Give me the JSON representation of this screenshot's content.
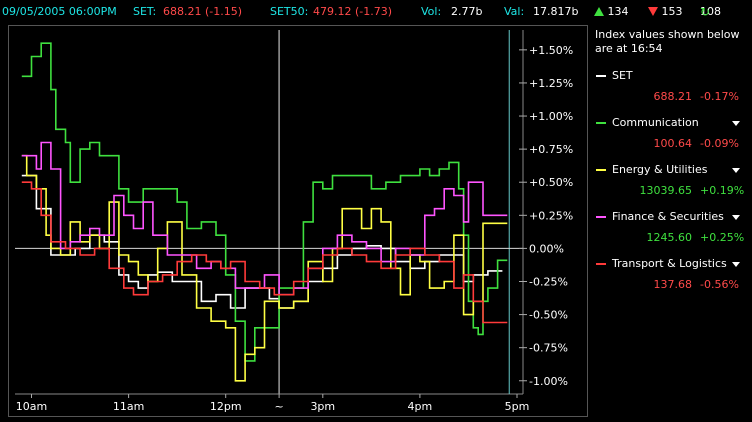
{
  "header": {
    "datetime": "09/05/2005 06:00PM",
    "set_label": "SET:",
    "set_value": "688.21 (-1.15)",
    "set50_label": "SET50:",
    "set50_value": "479.12 (-1.73)",
    "vol_label": "Vol:",
    "vol_value": "2.77b",
    "val_label": "Val:",
    "val_value": "17.817b",
    "up_count": "134",
    "down_count": "153",
    "unchanged_count": "108"
  },
  "sidebar": {
    "heading": "Index values shown below are at 16:54",
    "indices": [
      {
        "name": "SET",
        "value": "688.21",
        "change": "-0.17%",
        "color": "#ffffff",
        "value_color": "#ff4a4a",
        "dropdown": false
      },
      {
        "name": "Communication",
        "value": "100.64",
        "change": "-0.09%",
        "color": "#3fe03f",
        "value_color": "#ff4a4a",
        "dropdown": true
      },
      {
        "name": "Energy & Utilities",
        "value": "13039.65",
        "change": "+0.19%",
        "color": "#ffff44",
        "value_color": "#3fe03f",
        "dropdown": true
      },
      {
        "name": "Finance & Securities",
        "value": "1245.60",
        "change": "+0.25%",
        "color": "#ff55ff",
        "value_color": "#3fe03f",
        "dropdown": true
      },
      {
        "name": "Transport & Logistics",
        "value": "137.68",
        "change": "-0.56%",
        "color": "#ff3a3a",
        "value_color": "#ff4a4a",
        "dropdown": true
      }
    ]
  },
  "chart_data": {
    "type": "line",
    "y_unit": "percent change",
    "ylim": [
      -1.1,
      1.65
    ],
    "y_ticks": [
      1.5,
      1.25,
      1.0,
      0.75,
      0.5,
      0.25,
      0.0,
      -0.25,
      -0.5,
      -0.75,
      -1.0
    ],
    "y_tick_labels": [
      "+1.50%",
      "+1.25%",
      "+1.00%",
      "+0.75%",
      "+0.50%",
      "+0.25%",
      "0.00%",
      "-0.25%",
      "-0.50%",
      "-0.75%",
      "-1.00%"
    ],
    "x_ticks": [
      10,
      11,
      12,
      12.55,
      13,
      14,
      15
    ],
    "x_tick_labels": [
      "10am",
      "11am",
      "12pm",
      "~",
      "3pm",
      "4pm",
      "5pm"
    ],
    "xlim": [
      9.83,
      15.0
    ],
    "session_break_x": 12.55,
    "end_marker_x": 14.92,
    "grid": false,
    "series": [
      {
        "name": "SET",
        "color": "#ffffff",
        "points": [
          [
            9.9,
            0.55
          ],
          [
            10.05,
            0.3
          ],
          [
            10.2,
            -0.05
          ],
          [
            10.3,
            -0.05
          ],
          [
            10.45,
            0.0
          ],
          [
            10.6,
            0.1
          ],
          [
            10.75,
            0.05
          ],
          [
            10.9,
            -0.2
          ],
          [
            11.0,
            -0.25
          ],
          [
            11.1,
            -0.3
          ],
          [
            11.2,
            -0.2
          ],
          [
            11.3,
            -0.18
          ],
          [
            11.45,
            -0.25
          ],
          [
            11.6,
            -0.25
          ],
          [
            11.75,
            -0.4
          ],
          [
            11.9,
            -0.35
          ],
          [
            12.05,
            -0.45
          ],
          [
            12.2,
            -0.3
          ],
          [
            12.3,
            -0.3
          ],
          [
            12.45,
            -0.38
          ],
          [
            12.55,
            -0.45
          ],
          [
            12.7,
            -0.4
          ],
          [
            12.85,
            -0.25
          ],
          [
            13.0,
            -0.15
          ],
          [
            13.15,
            -0.05
          ],
          [
            13.3,
            0.0
          ],
          [
            13.45,
            0.02
          ],
          [
            13.6,
            0.0
          ],
          [
            13.75,
            -0.1
          ],
          [
            13.9,
            -0.15
          ],
          [
            14.05,
            -0.1
          ],
          [
            14.2,
            -0.05
          ],
          [
            14.35,
            -0.05
          ],
          [
            14.45,
            -0.25
          ],
          [
            14.55,
            -0.2
          ],
          [
            14.7,
            -0.17
          ],
          [
            14.85,
            -0.17
          ]
        ]
      },
      {
        "name": "Communication",
        "color": "#3fe03f",
        "points": [
          [
            9.9,
            1.3
          ],
          [
            9.95,
            1.3
          ],
          [
            10.0,
            1.45
          ],
          [
            10.1,
            1.55
          ],
          [
            10.2,
            1.2
          ],
          [
            10.25,
            0.9
          ],
          [
            10.35,
            0.8
          ],
          [
            10.4,
            0.5
          ],
          [
            10.5,
            0.75
          ],
          [
            10.6,
            0.8
          ],
          [
            10.7,
            0.7
          ],
          [
            10.8,
            0.7
          ],
          [
            10.9,
            0.45
          ],
          [
            11.0,
            0.35
          ],
          [
            11.15,
            0.45
          ],
          [
            11.3,
            0.45
          ],
          [
            11.5,
            0.35
          ],
          [
            11.6,
            0.15
          ],
          [
            11.75,
            0.2
          ],
          [
            11.9,
            0.1
          ],
          [
            12.0,
            -0.2
          ],
          [
            12.1,
            -0.55
          ],
          [
            12.2,
            -0.85
          ],
          [
            12.3,
            -0.6
          ],
          [
            12.45,
            -0.6
          ],
          [
            12.55,
            -0.3
          ],
          [
            12.7,
            -0.3
          ],
          [
            12.8,
            0.2
          ],
          [
            12.9,
            0.5
          ],
          [
            13.0,
            0.45
          ],
          [
            13.1,
            0.55
          ],
          [
            13.3,
            0.55
          ],
          [
            13.5,
            0.45
          ],
          [
            13.65,
            0.5
          ],
          [
            13.8,
            0.55
          ],
          [
            14.0,
            0.6
          ],
          [
            14.1,
            0.55
          ],
          [
            14.2,
            0.6
          ],
          [
            14.3,
            0.65
          ],
          [
            14.4,
            0.45
          ],
          [
            14.45,
            0.1
          ],
          [
            14.5,
            -0.4
          ],
          [
            14.55,
            -0.6
          ],
          [
            14.6,
            -0.65
          ],
          [
            14.65,
            -0.4
          ],
          [
            14.7,
            -0.3
          ],
          [
            14.8,
            -0.09
          ],
          [
            14.9,
            -0.09
          ]
        ]
      },
      {
        "name": "Energy & Utilities",
        "color": "#ffff44",
        "points": [
          [
            9.9,
            0.7
          ],
          [
            9.95,
            0.55
          ],
          [
            10.05,
            0.45
          ],
          [
            10.15,
            0.1
          ],
          [
            10.2,
            0.0
          ],
          [
            10.3,
            -0.05
          ],
          [
            10.4,
            0.2
          ],
          [
            10.5,
            0.05
          ],
          [
            10.6,
            0.1
          ],
          [
            10.7,
            0.0
          ],
          [
            10.8,
            0.35
          ],
          [
            10.9,
            -0.05
          ],
          [
            11.0,
            -0.1
          ],
          [
            11.1,
            -0.2
          ],
          [
            11.2,
            -0.25
          ],
          [
            11.3,
            0.0
          ],
          [
            11.4,
            0.2
          ],
          [
            11.5,
            0.2
          ],
          [
            11.55,
            -0.2
          ],
          [
            11.7,
            -0.45
          ],
          [
            11.85,
            -0.55
          ],
          [
            12.0,
            -0.6
          ],
          [
            12.1,
            -1.0
          ],
          [
            12.2,
            -0.8
          ],
          [
            12.3,
            -0.75
          ],
          [
            12.4,
            -0.4
          ],
          [
            12.5,
            -0.4
          ],
          [
            12.55,
            -0.45
          ],
          [
            12.7,
            -0.4
          ],
          [
            12.85,
            -0.1
          ],
          [
            13.0,
            -0.25
          ],
          [
            13.1,
            0.0
          ],
          [
            13.2,
            0.3
          ],
          [
            13.3,
            0.3
          ],
          [
            13.4,
            0.15
          ],
          [
            13.5,
            0.3
          ],
          [
            13.6,
            0.2
          ],
          [
            13.7,
            -0.15
          ],
          [
            13.8,
            -0.35
          ],
          [
            13.9,
            -0.05
          ],
          [
            14.0,
            -0.1
          ],
          [
            14.1,
            -0.3
          ],
          [
            14.25,
            -0.25
          ],
          [
            14.35,
            0.1
          ],
          [
            14.45,
            -0.5
          ],
          [
            14.55,
            -0.4
          ],
          [
            14.65,
            0.19
          ],
          [
            14.9,
            0.19
          ]
        ]
      },
      {
        "name": "Finance & Securities",
        "color": "#ff55ff",
        "points": [
          [
            9.9,
            0.7
          ],
          [
            10.0,
            0.7
          ],
          [
            10.05,
            0.6
          ],
          [
            10.1,
            0.8
          ],
          [
            10.2,
            0.6
          ],
          [
            10.3,
            0.0
          ],
          [
            10.4,
            0.05
          ],
          [
            10.5,
            0.1
          ],
          [
            10.6,
            0.15
          ],
          [
            10.7,
            0.1
          ],
          [
            10.85,
            0.4
          ],
          [
            10.95,
            0.25
          ],
          [
            11.05,
            0.15
          ],
          [
            11.15,
            0.35
          ],
          [
            11.25,
            0.1
          ],
          [
            11.4,
            -0.05
          ],
          [
            11.55,
            -0.05
          ],
          [
            11.7,
            -0.15
          ],
          [
            11.85,
            -0.1
          ],
          [
            11.95,
            -0.15
          ],
          [
            12.1,
            -0.3
          ],
          [
            12.25,
            -0.3
          ],
          [
            12.4,
            -0.2
          ],
          [
            12.55,
            -0.35
          ],
          [
            12.7,
            -0.3
          ],
          [
            12.85,
            -0.15
          ],
          [
            13.0,
            0.0
          ],
          [
            13.15,
            0.1
          ],
          [
            13.3,
            0.05
          ],
          [
            13.45,
            0.0
          ],
          [
            13.6,
            -0.1
          ],
          [
            13.75,
            0.0
          ],
          [
            13.9,
            -0.05
          ],
          [
            14.05,
            0.25
          ],
          [
            14.15,
            0.3
          ],
          [
            14.25,
            0.45
          ],
          [
            14.35,
            0.4
          ],
          [
            14.45,
            0.2
          ],
          [
            14.5,
            0.5
          ],
          [
            14.6,
            0.5
          ],
          [
            14.65,
            0.25
          ],
          [
            14.9,
            0.25
          ]
        ]
      },
      {
        "name": "Transport & Logistics",
        "color": "#ff3a3a",
        "points": [
          [
            9.9,
            0.5
          ],
          [
            10.0,
            0.45
          ],
          [
            10.1,
            0.25
          ],
          [
            10.2,
            0.05
          ],
          [
            10.35,
            0.0
          ],
          [
            10.5,
            -0.05
          ],
          [
            10.65,
            0.0
          ],
          [
            10.8,
            -0.15
          ],
          [
            10.95,
            -0.3
          ],
          [
            11.05,
            -0.35
          ],
          [
            11.2,
            -0.25
          ],
          [
            11.35,
            -0.2
          ],
          [
            11.5,
            -0.1
          ],
          [
            11.65,
            -0.05
          ],
          [
            11.8,
            -0.1
          ],
          [
            11.95,
            -0.15
          ],
          [
            12.05,
            -0.1
          ],
          [
            12.2,
            -0.25
          ],
          [
            12.35,
            -0.3
          ],
          [
            12.5,
            -0.35
          ],
          [
            12.55,
            -0.35
          ],
          [
            12.7,
            -0.25
          ],
          [
            12.85,
            -0.15
          ],
          [
            13.0,
            -0.05
          ],
          [
            13.15,
            0.0
          ],
          [
            13.3,
            -0.05
          ],
          [
            13.45,
            -0.1
          ],
          [
            13.6,
            -0.15
          ],
          [
            13.75,
            -0.05
          ],
          [
            13.9,
            0.0
          ],
          [
            14.05,
            -0.05
          ],
          [
            14.2,
            -0.1
          ],
          [
            14.35,
            -0.3
          ],
          [
            14.45,
            -0.2
          ],
          [
            14.55,
            -0.4
          ],
          [
            14.65,
            -0.56
          ],
          [
            14.9,
            -0.56
          ]
        ]
      }
    ]
  }
}
